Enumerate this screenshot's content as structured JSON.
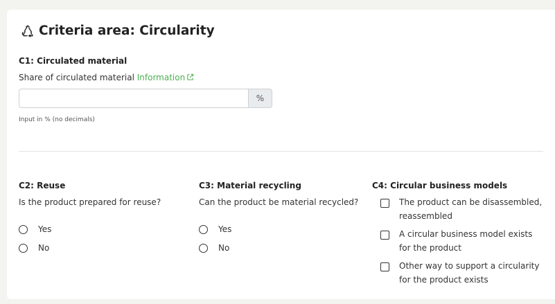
{
  "section": {
    "icon": "recycle-icon",
    "title": "Criteria area: Circularity"
  },
  "c1": {
    "heading": "C1: Circulated material",
    "question": "Share of circulated material",
    "info_link": "Information",
    "info_icon": "external-link-icon",
    "input_value": "",
    "input_placeholder": "",
    "unit": "%",
    "hint": "Input in % (no decimals)"
  },
  "c2": {
    "heading": "C2: Reuse",
    "question": "Is the product prepared for reuse?",
    "options": [
      "Yes",
      "No"
    ]
  },
  "c3": {
    "heading": "C3: Material recycling",
    "question": "Can the product be material recycled?",
    "options": [
      "Yes",
      "No"
    ]
  },
  "c4": {
    "heading": "C4: Circular business models",
    "options": [
      "The product can be disassembled, reassembled",
      "A circular business model exists for the product",
      "Other way to support a circularity for the product exists"
    ]
  },
  "colors": {
    "link": "#4caf50",
    "background": "#f3f3ef",
    "card": "#ffffff",
    "addon": "#e9ecef"
  }
}
